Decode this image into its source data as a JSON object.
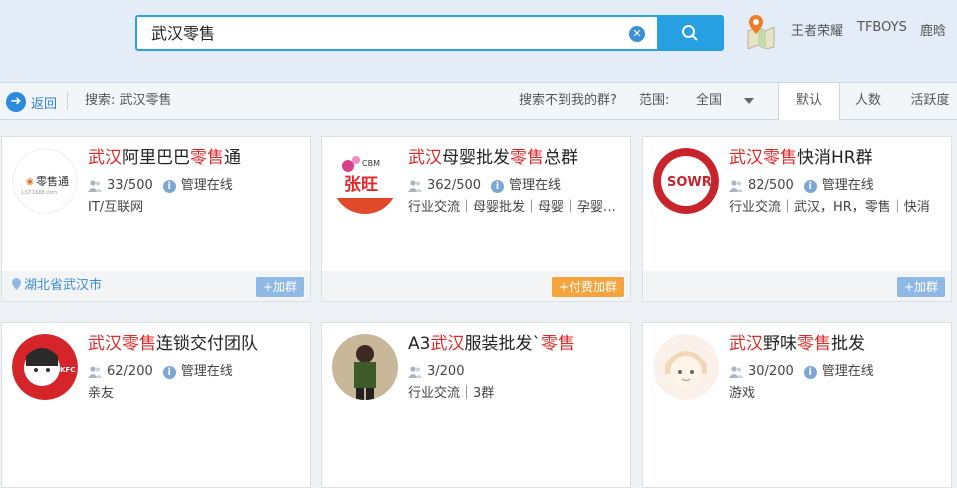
{
  "search": {
    "query": "武汉零售"
  },
  "hot_searches": [
    "王者荣耀",
    "TFBOYS",
    "鹿晗"
  ],
  "toolbar": {
    "back_label": "返回",
    "breadcrumb": "搜索: 武汉零售",
    "not_found": "搜索不到我的群?",
    "range_label": "范围:",
    "range_value": "全国",
    "tabs": [
      "默认",
      "人数",
      "活跃度"
    ]
  },
  "cards": [
    {
      "title_parts": [
        {
          "t": "武汉",
          "kw": true
        },
        {
          "t": "阿里巴巴",
          "kw": false
        },
        {
          "t": "零售",
          "kw": true
        },
        {
          "t": "通",
          "kw": false
        }
      ],
      "members": "33/500",
      "manage": "管理在线",
      "tags": "IT/互联网",
      "location": "湖北省武汉市",
      "join_label": "+加群",
      "join_color": "#8fb9e4",
      "avatar_text": "零售通"
    },
    {
      "title_parts": [
        {
          "t": "武汉",
          "kw": true
        },
        {
          "t": "母婴批发",
          "kw": false
        },
        {
          "t": "零售",
          "kw": true
        },
        {
          "t": "总群",
          "kw": false
        }
      ],
      "members": "362/500",
      "manage": "管理在线",
      "tags": "行业交流｜母婴批发｜母婴｜孕婴…",
      "location": "",
      "join_label": "+付费加群",
      "join_color": "#f4a43d",
      "avatar_text": "张旺"
    },
    {
      "title_parts": [
        {
          "t": "武汉",
          "kw": true
        },
        {
          "t": "零售",
          "kw": true
        },
        {
          "t": "快消HR群",
          "kw": false
        }
      ],
      "members": "82/500",
      "manage": "管理在线",
      "tags": "行业交流｜武汉，HR，零售｜快消",
      "location": "",
      "join_label": "+加群",
      "join_color": "#8fb9e4",
      "avatar_text": "SOWR"
    },
    {
      "title_parts": [
        {
          "t": "武汉",
          "kw": true
        },
        {
          "t": "零售",
          "kw": true
        },
        {
          "t": "连锁交付团队",
          "kw": false
        }
      ],
      "members": "62/200",
      "manage": "管理在线",
      "tags": "亲友",
      "location": "",
      "join_label": "",
      "join_color": "#8fb9e4",
      "avatar_text": "KFC"
    },
    {
      "title_parts": [
        {
          "t": "A3",
          "kw": false
        },
        {
          "t": "武汉",
          "kw": true
        },
        {
          "t": "服装批发`",
          "kw": false
        },
        {
          "t": "零售",
          "kw": true
        }
      ],
      "members": "3/200",
      "manage": "",
      "tags": "行业交流｜3群",
      "location": "",
      "join_label": "",
      "join_color": "#8fb9e4",
      "avatar_text": ""
    },
    {
      "title_parts": [
        {
          "t": "武汉",
          "kw": true
        },
        {
          "t": "野味",
          "kw": false
        },
        {
          "t": "零售",
          "kw": true
        },
        {
          "t": "批发",
          "kw": false
        }
      ],
      "members": "30/200",
      "manage": "管理在线",
      "tags": "游戏",
      "location": "",
      "join_label": "",
      "join_color": "#8fb9e4",
      "avatar_text": ""
    }
  ]
}
